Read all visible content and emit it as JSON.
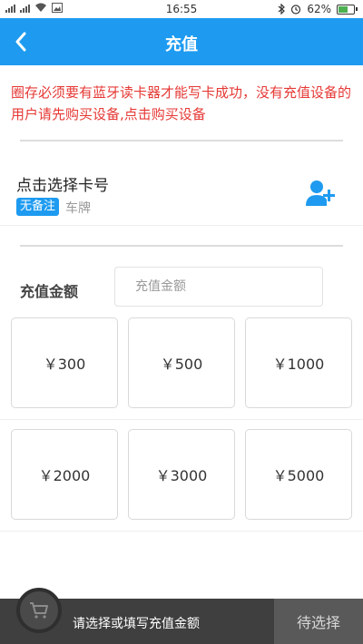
{
  "status_bar": {
    "time": "16:55",
    "battery_text": "62%",
    "battery_level": 0.62
  },
  "header": {
    "title": "充值",
    "back_icon": "chevron-left-icon"
  },
  "notice": {
    "text": "圈存必须要有蓝牙读卡器才能写卡成功，没有充值设备的用户请先购买设备,点击购买设备"
  },
  "card_select": {
    "label": "点击选择卡号",
    "tag": "无备注",
    "plate": "车牌",
    "icon": "add-user-icon"
  },
  "amount": {
    "label": "充值金额",
    "placeholder": "充值金额",
    "value": ""
  },
  "options": [
    "￥300",
    "￥500",
    "￥1000",
    "￥2000",
    "￥3000",
    "￥5000"
  ],
  "bottom": {
    "hint": "请选择或填写充值金额",
    "pending": "待选择",
    "cart_icon": "shopping-cart-icon"
  },
  "colors": {
    "accent": "#1e9bf0",
    "notice": "#e53935",
    "bottom_bar": "#3f3f3f"
  }
}
